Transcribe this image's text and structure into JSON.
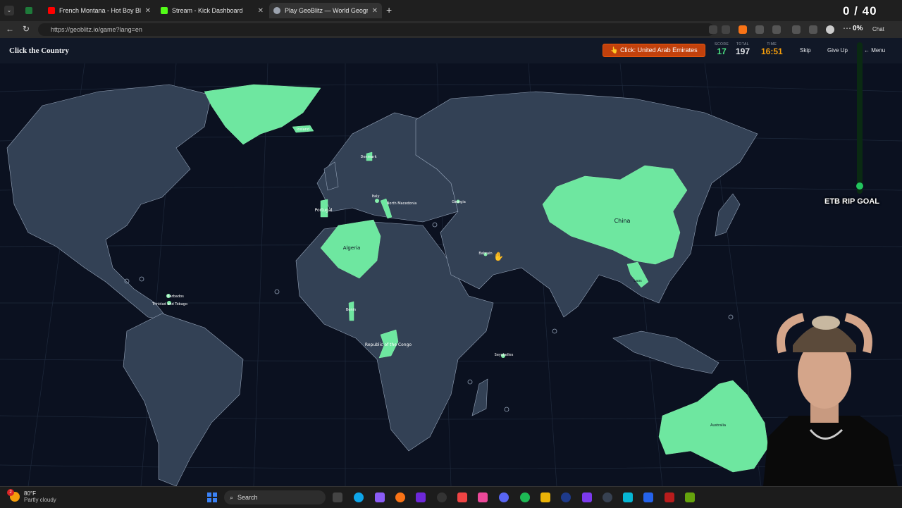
{
  "browser": {
    "tabs": [
      {
        "title": "French Montana - Hot Boy Bling ft",
        "fav_color": "#ff0000"
      },
      {
        "title": "Stream - Kick Dashboard",
        "fav_color": "#53fc18"
      },
      {
        "title": "Play GeoBlitz — World Geography",
        "fav_color": "#9ca3af"
      }
    ],
    "url": "https://geoblitz.io/game?lang=en",
    "overlay_counter": "0 / 40",
    "percent": "0%",
    "chat_label": "Chat"
  },
  "game": {
    "title": "Click the Country",
    "prompt": "👆 Click: United Arab Emirates",
    "score_label": "SCORE",
    "score": "17",
    "total_label": "TOTAL",
    "total": "197",
    "time_label": "TIME",
    "time": "16:51",
    "skip_label": "Skip",
    "give_up_label": "Give Up",
    "menu_label": "← Menu"
  },
  "map": {
    "found_countries": [
      "Greenland",
      "Iceland",
      "Portugal",
      "Algeria",
      "Benin",
      "Republic of the Congo",
      "China",
      "Laos",
      "Australia",
      "Denmark",
      "Italy",
      "North Macedonia",
      "Georgia",
      "Bahrain",
      "Seychelles",
      "Barbados",
      "Trinidad and Tobago"
    ],
    "labels": {
      "iceland": "Iceland",
      "denmark": "Denmark",
      "italy": "Italy",
      "north_macedonia": "North Macedonia",
      "georgia": "Georgia",
      "portugal": "Portugal",
      "algeria": "Algeria",
      "bahrain": "Bahrain",
      "benin": "Benin",
      "congo": "Republic of the Congo",
      "seychelles": "Seychelles",
      "barbados": "Barbados",
      "trinidad": "Trinidad and Tobago",
      "china": "China",
      "laos": "Laos",
      "australia": "Australia"
    },
    "colors": {
      "land": "#334155",
      "found": "#6ee7a0",
      "ocean": "#0b1120",
      "border": "#94a3b8"
    }
  },
  "overlay": {
    "goal_text": "ETB RIP GOAL",
    "goal_progress": 0.03
  },
  "taskbar": {
    "weather_temp": "80°F",
    "weather_desc": "Partly cloudy",
    "weather_badge": "2",
    "search_placeholder": "Search"
  }
}
